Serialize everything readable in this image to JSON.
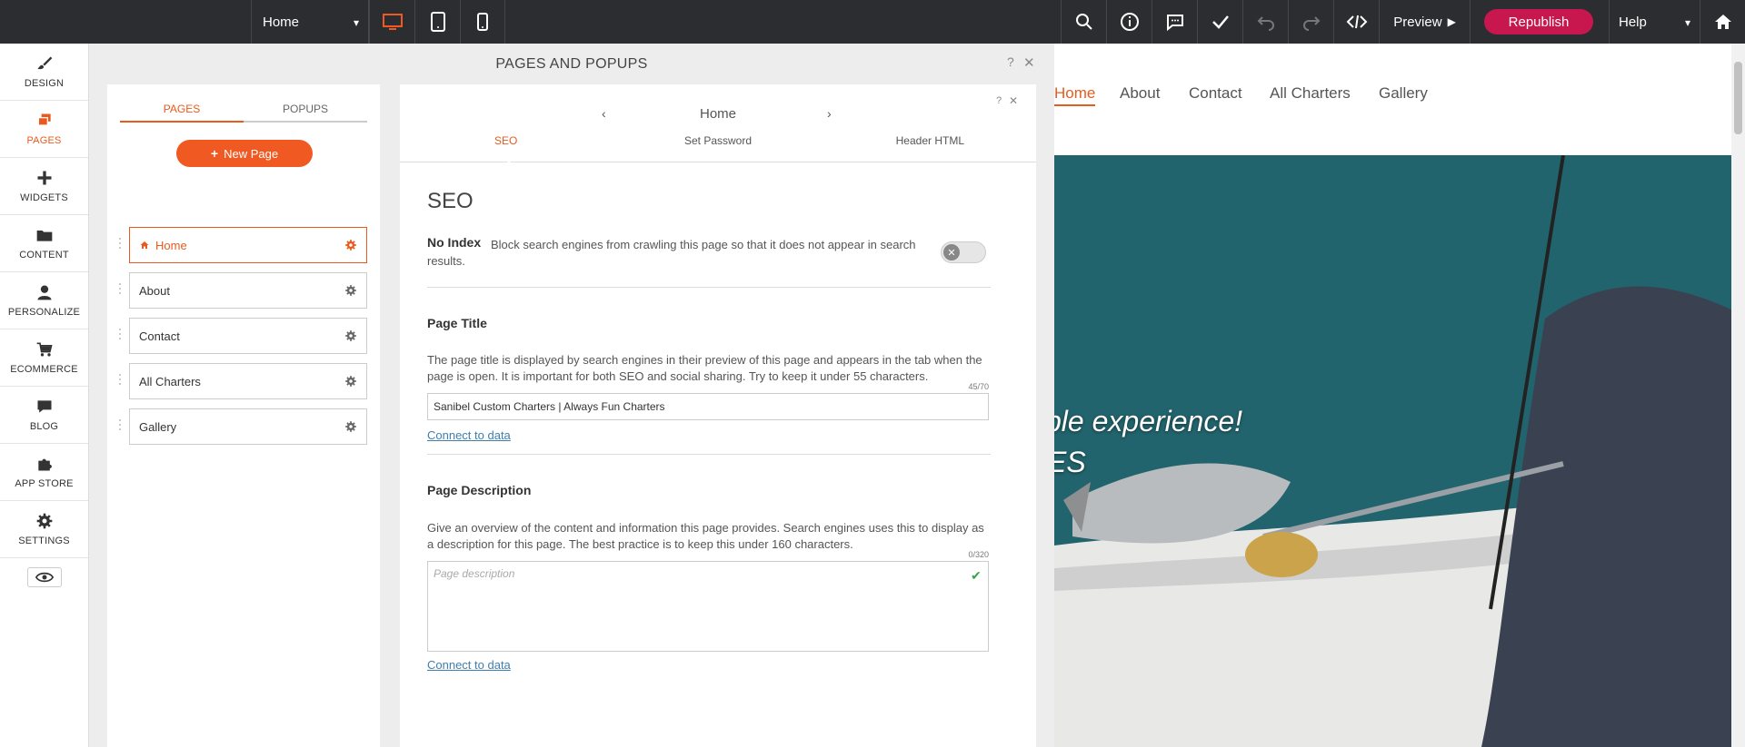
{
  "topbar": {
    "page_select": "Home",
    "preview_label": "Preview",
    "republish_label": "Republish",
    "help_label": "Help",
    "accent": "#c8164e"
  },
  "sidebar": {
    "items": [
      {
        "label": "DESIGN",
        "icon": "brush-icon"
      },
      {
        "label": "PAGES",
        "icon": "pages-icon"
      },
      {
        "label": "WIDGETS",
        "icon": "plus-icon"
      },
      {
        "label": "CONTENT",
        "icon": "folder-icon"
      },
      {
        "label": "PERSONALIZE",
        "icon": "person-icon"
      },
      {
        "label": "ECOMMERCE",
        "icon": "cart-icon"
      },
      {
        "label": "BLOG",
        "icon": "chat-icon"
      },
      {
        "label": "APP STORE",
        "icon": "puzzle-icon"
      },
      {
        "label": "SETTINGS",
        "icon": "gear-icon"
      }
    ]
  },
  "panel": {
    "title": "PAGES AND POPUPS",
    "help": "?",
    "close": "✕",
    "tabs": [
      "PAGES",
      "POPUPS"
    ],
    "new_page_label": "New Page",
    "pages": [
      "Home",
      "About",
      "Contact",
      "All Charters",
      "Gallery"
    ]
  },
  "dialog": {
    "page_name": "Home",
    "help": "?",
    "close": "✕",
    "tabs": [
      "SEO",
      "Set Password",
      "Header HTML"
    ],
    "heading": "SEO",
    "no_index": {
      "label": "No Index",
      "text": "Block search engines from crawling this page so that it does not appear in search results."
    },
    "page_title": {
      "label": "Page Title",
      "text": "The page title is displayed by search engines in their preview of this page and appears in the tab when the page is open. It is important for both SEO and social sharing. Try to keep it under 55 characters.",
      "counter": "45/70",
      "value": "Sanibel Custom Charters | Always Fun Charters",
      "link": "Connect to data"
    },
    "page_description": {
      "label": "Page Description",
      "text": "Give an overview of the content and information this page provides. Search engines uses this to display as a description for this page. The best practice is to keep this under 160 characters.",
      "counter": "0/320",
      "placeholder": "Page description",
      "link": "Connect to data"
    }
  },
  "site": {
    "nav": [
      "Home",
      "About",
      "Contact",
      "All Charters",
      "Gallery"
    ],
    "hero_line1": "ble experience!",
    "hero_line2": "ES"
  }
}
